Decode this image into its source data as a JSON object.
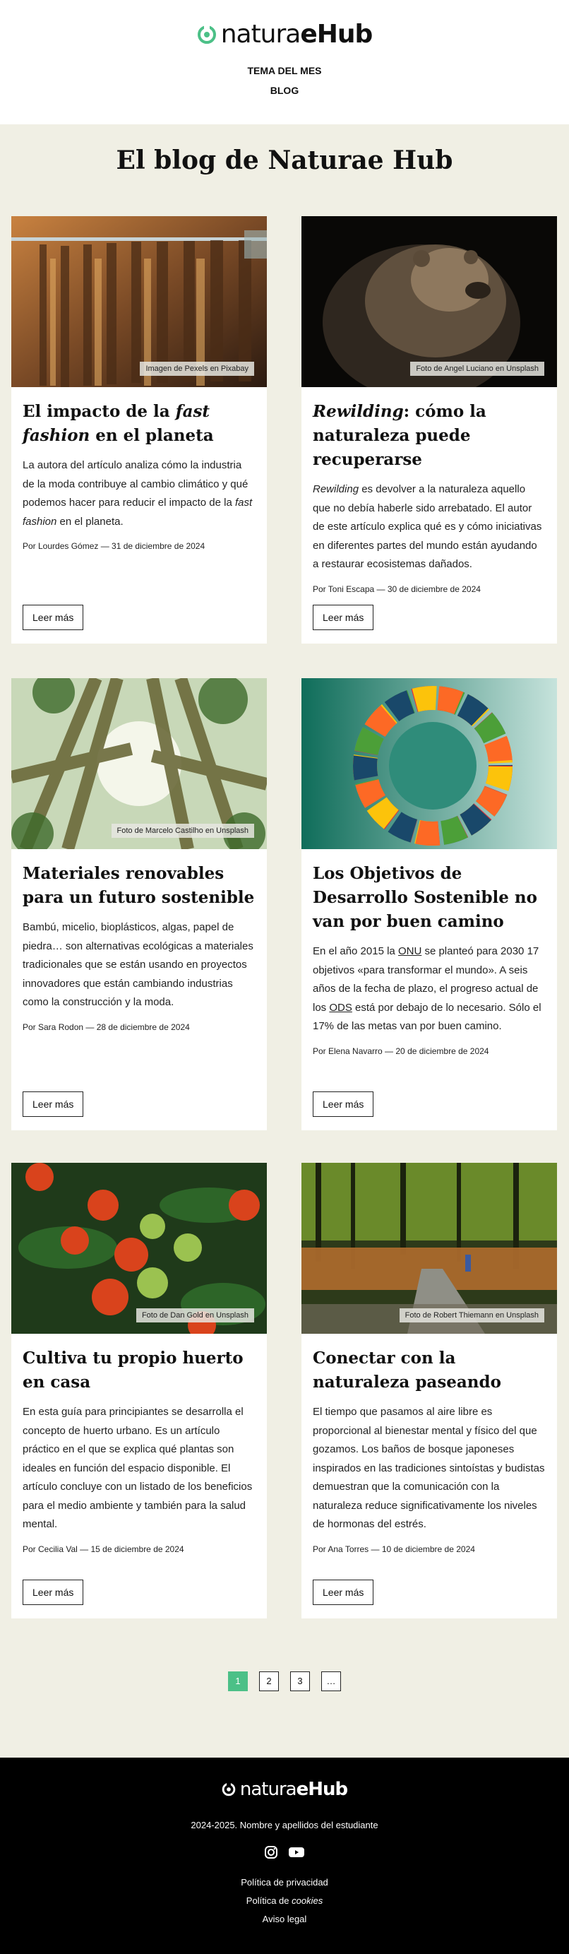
{
  "site": {
    "logo": {
      "thin": "natura",
      "bold_e": "e",
      "bold": "Hub"
    },
    "nav": [
      "TEMA DEL MES",
      "BLOG"
    ]
  },
  "page_title": "El blog de Naturae Hub",
  "posts": [
    {
      "title_pre": "El impacto de la ",
      "title_em": "fast fashion",
      "title_post": " en el planeta",
      "excerpt_pre": "La autora del artículo analiza cómo la industria de la moda contribuye al cambio climático y qué podemos hacer para reducir el impacto de la ",
      "excerpt_em": "fast fashion",
      "excerpt_post": " en el planeta.",
      "meta": "Por Lourdes Gómez — 31 de diciembre de 2024",
      "credit": "Imagen de Pexels en Pixabay",
      "button": "Leer más"
    },
    {
      "title_em": "Rewilding",
      "title_post": ": cómo la naturaleza puede recuperarse",
      "excerpt_em": "Rewilding",
      "excerpt_post": " es devolver a la naturaleza aquello que no debía haberle sido arrebatado. El autor de este artículo explica qué es y cómo iniciativas en diferentes partes del mundo están ayudando a restaurar ecosistemas dañados.",
      "meta": "Por Toni Escapa — 30 de diciembre de 2024",
      "credit": "Foto de Angel Luciano en Unsplash",
      "button": "Leer más"
    },
    {
      "title": "Materiales renovables para un futuro sostenible",
      "excerpt": "Bambú, micelio, bioplásticos, algas, papel de piedra… son alternativas ecológicas a materiales tradicionales que se están usando en proyectos innovadores que están cambiando industrias como la construcción y la moda.",
      "meta": "Por Sara Rodon — 28 de diciembre de 2024",
      "credit": "Foto de Marcelo Castilho en Unsplash",
      "button": "Leer más"
    },
    {
      "title": "Los Objetivos de Desarrollo Sostenible no van por buen camino",
      "excerpt_a": "En el año 2015 la ",
      "abbr1": "ONU",
      "excerpt_b": " se planteó para 2030 17 objetivos «para transformar el mundo». A seis años de la fecha de plazo, el progreso actual de los ",
      "abbr2": "ODS",
      "excerpt_c": " está por debajo de lo necesario. Sólo el 17% de las metas van por buen camino.",
      "meta": "Por Elena Navarro — 20 de diciembre de 2024",
      "button": "Leer más"
    },
    {
      "title": "Cultiva tu propio huerto en casa",
      "excerpt": "En esta guía para principiantes se desarrolla el concepto de huerto urbano. Es un artículo práctico en el que se explica qué plantas son ideales en función del espacio disponible. El artículo concluye con un listado de los beneficios para el medio ambiente y también para la salud mental.",
      "meta": "Por Cecilia Val — 15 de diciembre de 2024",
      "credit": "Foto de Dan Gold en Unsplash",
      "button": "Leer más"
    },
    {
      "title": "Conectar con la naturaleza paseando",
      "excerpt": "El tiempo que pasamos al aire libre es proporcional al bienestar mental y físico del que gozamos. Los baños de bosque japoneses inspirados en las tradiciones sintoístas y budistas demuestran que la comunicación con la naturaleza reduce significativamente los niveles de hormonas del estrés.",
      "meta": "Por Ana Torres — 10 de diciembre de 2024",
      "credit": "Foto de Robert Thiemann en Unsplash",
      "button": "Leer más"
    }
  ],
  "pagination": [
    "1",
    "2",
    "3",
    "…"
  ],
  "footer": {
    "copyright": "2024-2025. Nombre y apellidos del estudiante",
    "social_icons": [
      "instagram-icon",
      "youtube-icon"
    ],
    "links": {
      "privacy": "Política de privacidad",
      "cookies_pre": "Política de ",
      "cookies_em": "cookies",
      "legal": "Aviso legal"
    }
  },
  "colors": {
    "accent": "#4cc087",
    "background": "#f0efe4",
    "footer": "#000000"
  }
}
